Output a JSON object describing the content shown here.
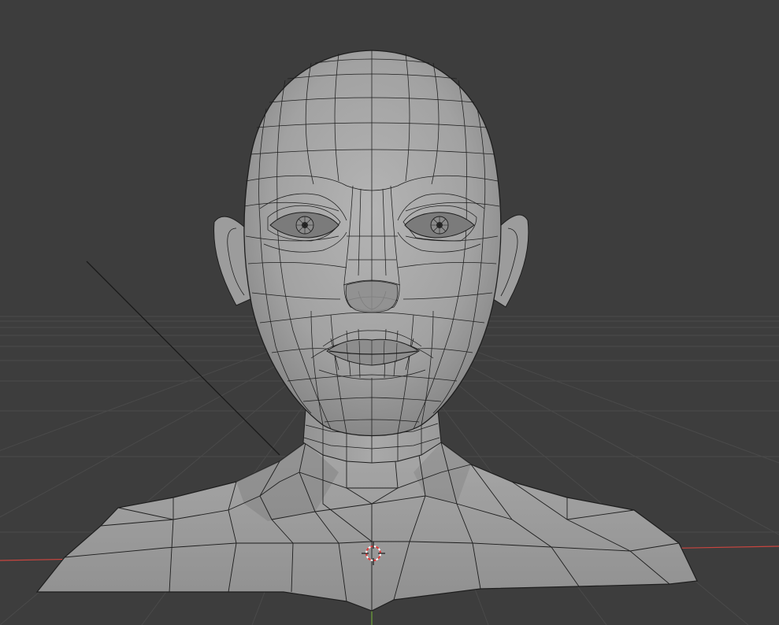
{
  "viewport": {
    "background_color": "#3d3d3d",
    "grid_color": "#4a4a4a",
    "x_axis_color": "#c9453f",
    "y_axis_color": "#6fa53a",
    "mesh_fill_color": "#9b9b9b",
    "mesh_shadow_color": "#6e6e6e",
    "wire_color": "#1e1e1e",
    "cursor_primary_color": "#e03a3a",
    "cursor_secondary_color": "#ffffff"
  },
  "object": {
    "type": "mesh",
    "display": "solid-with-wireframe",
    "subject": "head-and-shoulders-bust"
  },
  "icons": {
    "cursor": "3d-cursor-icon"
  }
}
